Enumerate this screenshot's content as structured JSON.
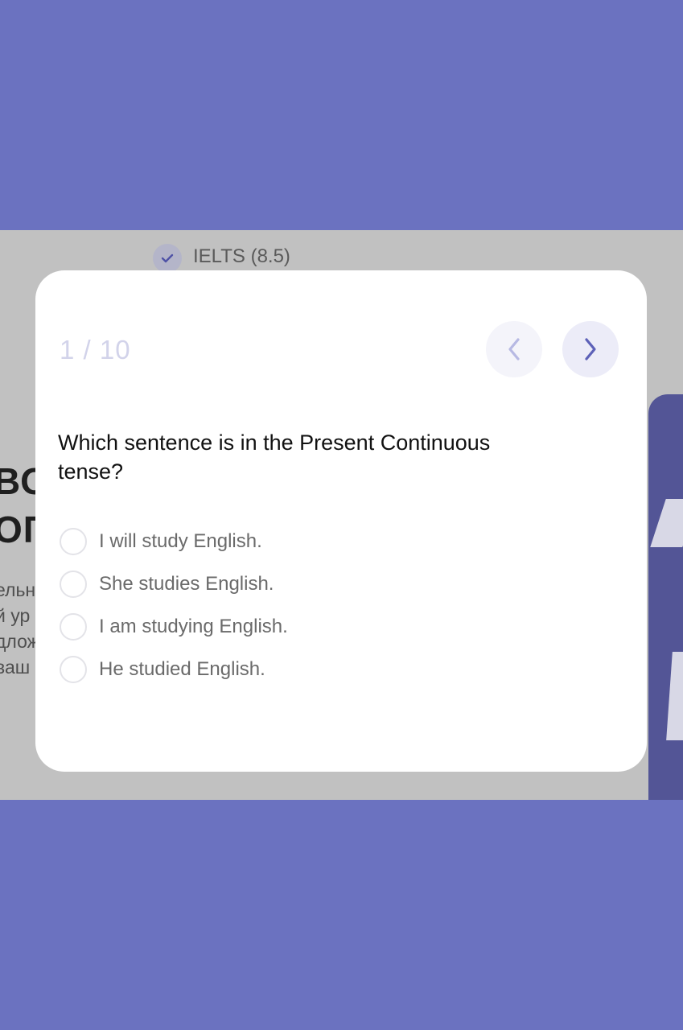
{
  "background": {
    "ielts_label": "IELTS (8.5)",
    "heading_line1": "ВО",
    "heading_line2": "ОГ",
    "text_lines": [
      "ельн",
      "й ур",
      "длож",
      "ваш"
    ]
  },
  "quiz": {
    "counter": "1 / 10",
    "question": "Which sentence is in the Present Continuous tense?",
    "options": [
      {
        "label": "I will study English."
      },
      {
        "label": "She studies English."
      },
      {
        "label": "I am studying English."
      },
      {
        "label": "He studied English."
      }
    ]
  },
  "colors": {
    "outer_background": "#6b72c0",
    "overlay": "#c1c1c1",
    "accent": "#6b72c0",
    "nav_prev_arrow": "#b7b9e3",
    "counter_text": "#d2d3ea"
  },
  "icons": {
    "check": "check-icon",
    "prev": "chevron-left-icon",
    "next": "chevron-right-icon"
  }
}
